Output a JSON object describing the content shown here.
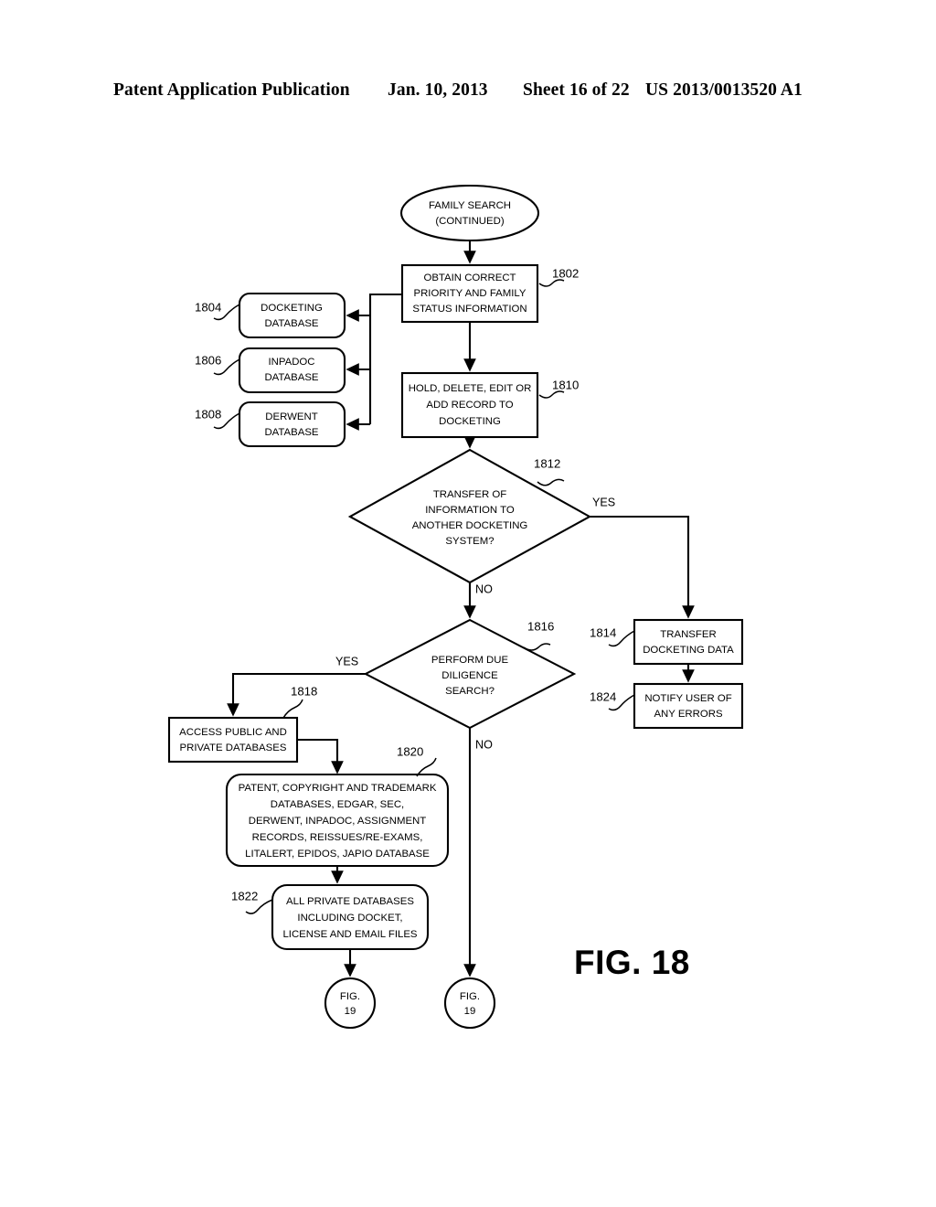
{
  "header": {
    "publication": "Patent Application Publication",
    "date": "Jan. 10, 2013",
    "sheet": "Sheet 16 of 22",
    "number": "US 2013/0013520 A1"
  },
  "figure": {
    "label": "FIG. 18"
  },
  "nodes": {
    "start": {
      "ref": "",
      "lines": [
        "FAMILY SEARCH",
        "(CONTINUED)"
      ],
      "shape": "oval"
    },
    "n1802": {
      "ref": "1802",
      "lines": [
        "OBTAIN CORRECT",
        "PRIORITY AND FAMILY",
        "STATUS INFORMATION"
      ],
      "shape": "rect"
    },
    "n1804": {
      "ref": "1804",
      "lines": [
        "DOCKETING",
        "DATABASE"
      ],
      "shape": "rounded"
    },
    "n1806": {
      "ref": "1806",
      "lines": [
        "INPADOC",
        "DATABASE"
      ],
      "shape": "rounded"
    },
    "n1808": {
      "ref": "1808",
      "lines": [
        "DERWENT",
        "DATABASE"
      ],
      "shape": "rounded"
    },
    "n1810": {
      "ref": "1810",
      "lines": [
        "HOLD, DELETE, EDIT OR",
        "ADD RECORD TO",
        "DOCKETING"
      ],
      "shape": "rect"
    },
    "n1812": {
      "ref": "1812",
      "lines": [
        "TRANSFER OF",
        "INFORMATION TO",
        "ANOTHER DOCKETING",
        "SYSTEM?"
      ],
      "shape": "diamond",
      "yes_label": "YES",
      "no_label": "NO"
    },
    "n1814": {
      "ref": "1814",
      "lines": [
        "TRANSFER",
        "DOCKETING DATA"
      ],
      "shape": "rect"
    },
    "n1816": {
      "ref": "1816",
      "lines": [
        "PERFORM DUE",
        "DILIGENCE",
        "SEARCH?"
      ],
      "shape": "diamond",
      "yes_label": "YES",
      "no_label": "NO"
    },
    "n1818": {
      "ref": "1818",
      "lines": [
        "ACCESS PUBLIC AND",
        "PRIVATE DATABASES"
      ],
      "shape": "rect"
    },
    "n1820": {
      "ref": "1820",
      "lines": [
        "PATENT, COPYRIGHT AND TRADEMARK",
        "DATABASES, EDGAR, SEC,",
        "DERWENT, INPADOC, ASSIGNMENT",
        "RECORDS, REISSUES/RE-EXAMS,",
        "LITALERT, EPIDOS, JAPIO DATABASE"
      ],
      "shape": "rounded"
    },
    "n1822": {
      "ref": "1822",
      "lines": [
        "ALL PRIVATE DATABASES",
        "INCLUDING DOCKET,",
        "LICENSE AND EMAIL FILES"
      ],
      "shape": "rounded"
    },
    "n1824": {
      "ref": "1824",
      "lines": [
        "NOTIFY USER OF",
        "ANY ERRORS"
      ],
      "shape": "rect"
    },
    "conn_left": {
      "ref": "",
      "lines": [
        "FIG.",
        "19"
      ],
      "shape": "circle"
    },
    "conn_right": {
      "ref": "",
      "lines": [
        "FIG.",
        "19"
      ],
      "shape": "circle"
    }
  },
  "colors": {
    "ink": "#000000",
    "paper": "#ffffff"
  }
}
